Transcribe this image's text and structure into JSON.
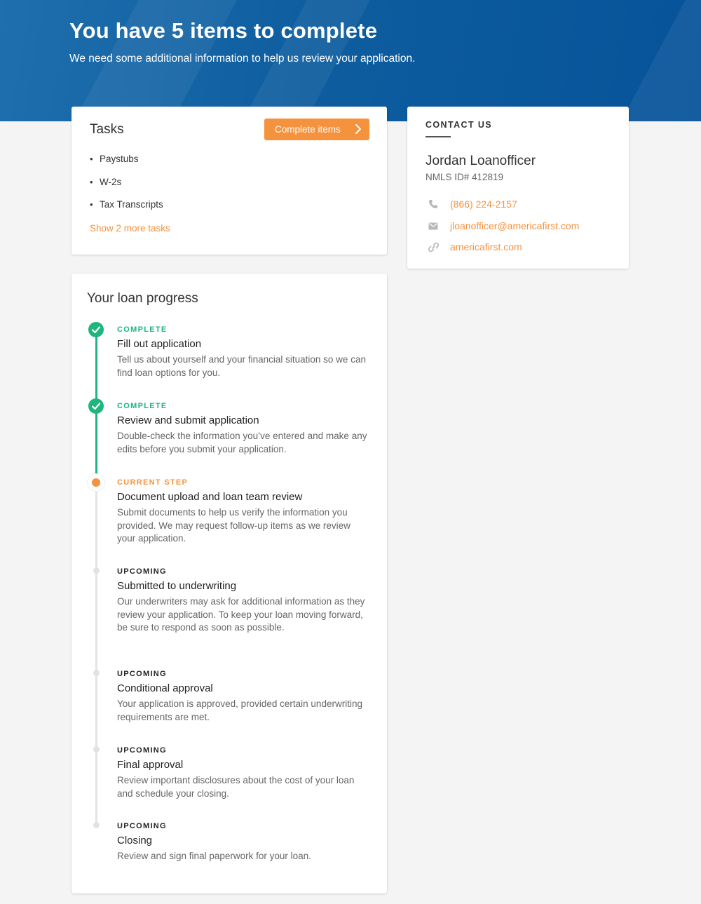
{
  "hero": {
    "title": "You have 5 items to complete",
    "subtitle": "We need some additional information to help us review your application."
  },
  "tasks": {
    "title": "Tasks",
    "button_label": "Complete items",
    "items": [
      "Paystubs",
      "W-2s",
      "Tax Transcripts"
    ],
    "show_more": "Show 2 more tasks"
  },
  "contact": {
    "heading": "CONTACT US",
    "name": "Jordan Loanofficer",
    "nmls": "NMLS ID# 412819",
    "phone": "(866) 224-2157",
    "email": "jloanofficer@americafirst.com",
    "website": "americafirst.com"
  },
  "progress": {
    "title": "Your loan progress",
    "steps": [
      {
        "status": "COMPLETE",
        "title": "Fill out application",
        "desc": "Tell us about yourself and your financial situation so we can find loan options for you."
      },
      {
        "status": "COMPLETE",
        "title": "Review and submit application",
        "desc": "Double-check the information you’ve entered and make any edits before you submit your application."
      },
      {
        "status": "CURRENT STEP",
        "title": "Document upload and loan team review",
        "desc": "Submit documents to help us verify the information you provided. We may request follow-up items as we review your application."
      },
      {
        "status": "UPCOMING",
        "title": "Submitted to underwriting",
        "desc": "Our underwriters may ask for additional information as they review your application. To keep your loan moving forward, be sure to respond as soon as possible."
      },
      {
        "status": "UPCOMING",
        "title": "Conditional approval",
        "desc": "Your application is approved, provided certain underwriting requirements are met."
      },
      {
        "status": "UPCOMING",
        "title": "Final approval",
        "desc": "Review important disclosures about the cost of your loan and schedule your closing."
      },
      {
        "status": "UPCOMING",
        "title": "Closing",
        "desc": "Review and sign final paperwork for your loan."
      }
    ]
  },
  "colors": {
    "accent": "#f5923e",
    "complete": "#1fb57f",
    "hero": "#0e5d9f",
    "upcoming": "#e2e2e2"
  },
  "icons": {
    "phone": "phone-icon",
    "email": "envelope-icon",
    "website": "link-icon",
    "check": "check-icon",
    "chevron": "chevron-right-icon"
  }
}
